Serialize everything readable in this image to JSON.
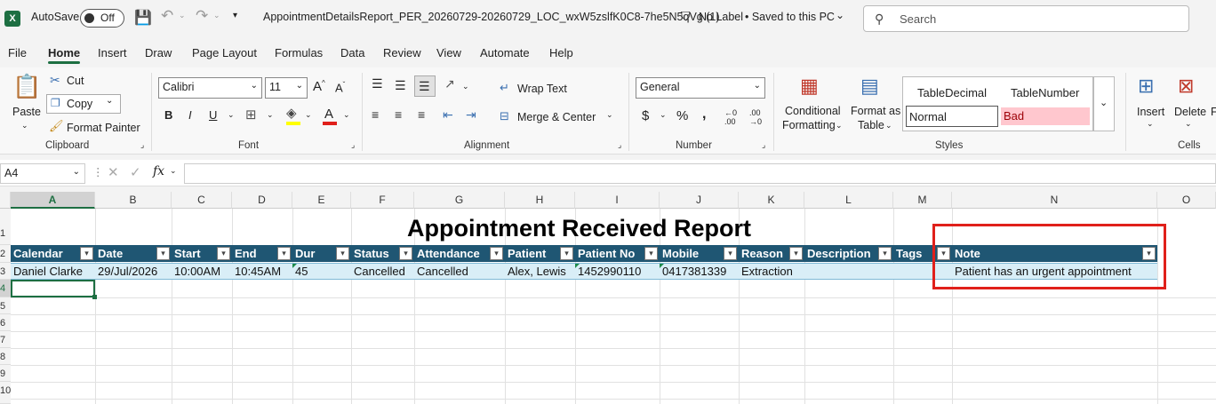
{
  "titlebar": {
    "app_letter": "X",
    "autosave_label": "AutoSave",
    "autosave_state": "Off",
    "filename": "AppointmentDetailsReport_PER_20260729-20260729_LOC_wxW5zslfK0C8-7he5N5qVg (1)",
    "label_status": "No Label",
    "saved_status": "• Saved to this PC",
    "search_placeholder": "Search"
  },
  "menu": [
    "File",
    "Home",
    "Insert",
    "Draw",
    "Page Layout",
    "Formulas",
    "Data",
    "Review",
    "View",
    "Automate",
    "Help"
  ],
  "ribbon": {
    "clipboard": {
      "paste": "Paste",
      "cut": "Cut",
      "copy": "Copy",
      "format_painter": "Format Painter",
      "label": "Clipboard"
    },
    "font": {
      "name": "Calibri",
      "size": "11",
      "label": "Font"
    },
    "alignment": {
      "wrap_text": "Wrap Text",
      "merge_center": "Merge & Center",
      "label": "Alignment"
    },
    "number": {
      "format": "General",
      "label": "Number"
    },
    "styles": {
      "conditional": "Conditional",
      "formatting": "Formatting",
      "format_as": "Format as",
      "table": "Table",
      "table_decimal": "TableDecimal",
      "table_number": "TableNumber",
      "normal": "Normal",
      "bad": "Bad",
      "label": "Styles"
    },
    "cells": {
      "insert": "Insert",
      "delete": "Delete",
      "label": "Cells"
    }
  },
  "formula_bar": {
    "name_box": "A4",
    "fx": "fx",
    "content": ""
  },
  "sheet": {
    "columns": [
      "A",
      "B",
      "C",
      "D",
      "E",
      "F",
      "G",
      "H",
      "I",
      "J",
      "K",
      "L",
      "M",
      "N",
      "O"
    ],
    "rows": [
      "1",
      "2",
      "3",
      "4",
      "5",
      "6",
      "7",
      "8",
      "9",
      "10"
    ],
    "title": "Appointment Received Report",
    "headers": [
      "Calendar",
      "Date",
      "Start",
      "End",
      "Dur",
      "Status",
      "Attendance",
      "Patient",
      "Patient No",
      "Mobile",
      "Reason",
      "Description",
      "Tags",
      "Note"
    ],
    "row": [
      "Daniel Clarke",
      "29/Jul/2026",
      "10:00AM",
      "10:45AM",
      "45",
      "Cancelled",
      "Cancelled",
      "Alex, Lewis",
      "1452990110",
      "0417381339",
      "Extraction",
      "",
      "",
      "Patient has an urgent appointment"
    ]
  },
  "colors": {
    "header_bg": "#1f5673",
    "row_bg": "#d9eef7",
    "highlight": "#e0201b",
    "accent": "#1d6f42"
  }
}
